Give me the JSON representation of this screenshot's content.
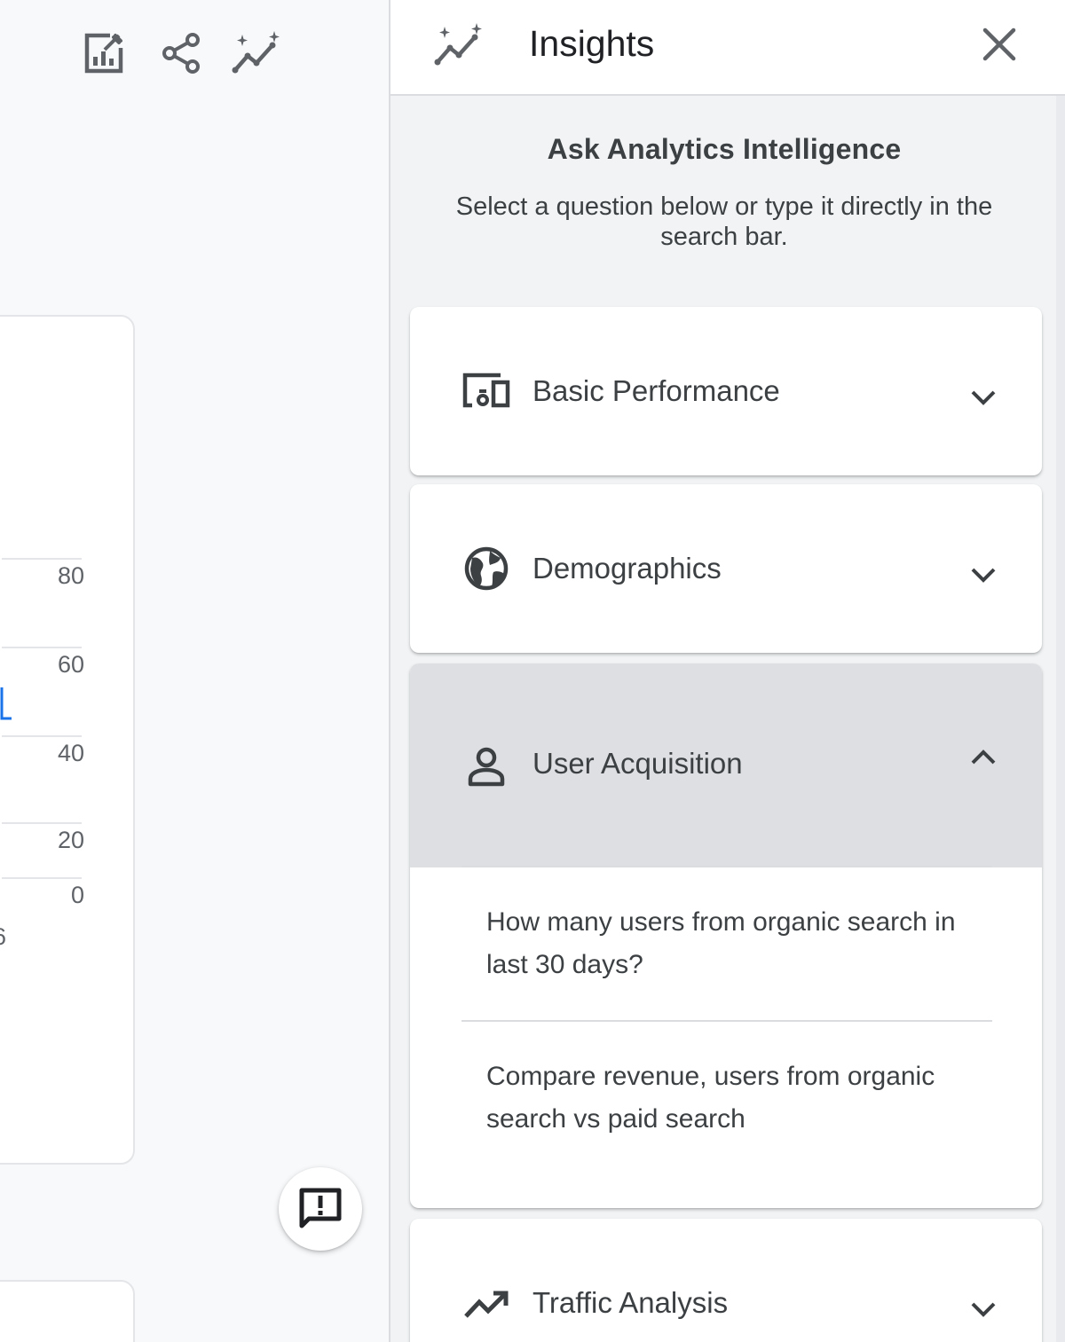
{
  "left_toolbar": {
    "icons": [
      "edit-report-icon",
      "share-icon",
      "insights-icon"
    ]
  },
  "left_chart": {
    "y_tick_labels": [
      "80",
      "60",
      "40",
      "20",
      "0"
    ],
    "x_tick_partial": "6",
    "series_color": "#1a73e8"
  },
  "insights": {
    "title": "Insights",
    "intro_title": "Ask Analytics Intelligence",
    "intro_subtitle": "Select a question below or type it directly in the search bar.",
    "sections": [
      {
        "label": "Basic Performance",
        "icon": "devices-icon",
        "expanded": false
      },
      {
        "label": "Demographics",
        "icon": "globe-icon",
        "expanded": false
      },
      {
        "label": "User Acquisition",
        "icon": "person-icon",
        "expanded": true,
        "questions": [
          "How many users from organic search in last 30 days?",
          "Compare revenue, users from organic search vs paid search"
        ]
      },
      {
        "label": "Traffic Analysis",
        "icon": "trending-up-icon",
        "expanded": false
      }
    ]
  },
  "colors": {
    "accent": "#1a73e8",
    "expanded_header_bg": "#dedfe2",
    "panel_bg": "#f1f3f4"
  }
}
